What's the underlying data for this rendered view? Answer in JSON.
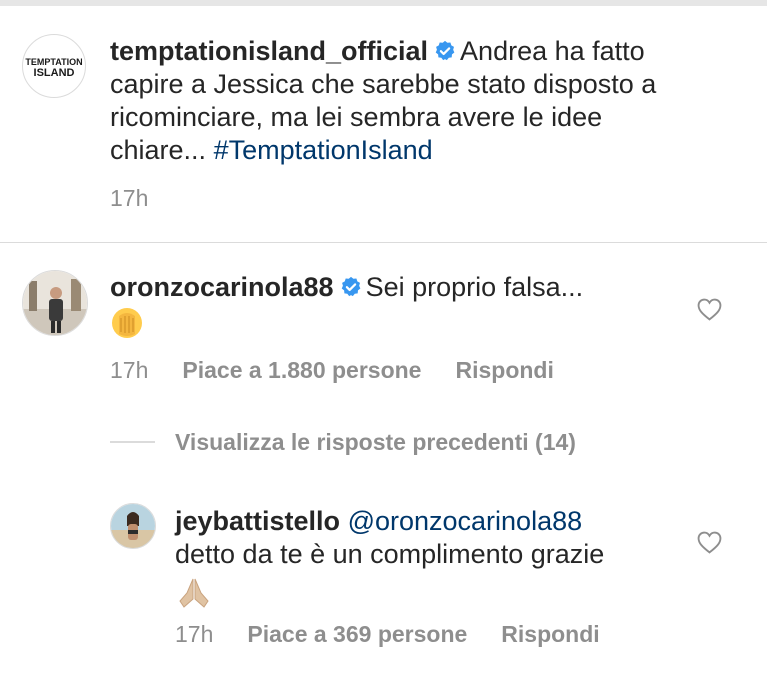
{
  "post": {
    "username": "temptationisland_official",
    "caption_line1": "Andrea ha fatto",
    "caption_line2": "capire a Jessica che sarebbe stato disposto a",
    "caption_line3": "ricominciare, ma lei sembra avere le idee",
    "caption_line4": "chiare...",
    "hashtag": "#TemptationIsland",
    "time": "17h",
    "avatar_logo_line1": "TEMPTATION",
    "avatar_logo_line2": "ISLAND"
  },
  "comment1": {
    "username": "oronzocarinola88",
    "text": "Sei proprio falsa...",
    "emoji_icon": "face-palm-icon",
    "time": "17h",
    "likes": "Piace a 1.880 persone",
    "reply": "Rispondi"
  },
  "view_replies": "Visualizza le risposte precedenti (14)",
  "reply1": {
    "username": "jeybattistello",
    "mention": "@oronzocarinola88",
    "text": "detto da te è un complimento grazie",
    "emoji_icon": "folded-hands-icon",
    "time": "17h",
    "likes": "Piace a 369 persone",
    "reply": "Rispondi"
  },
  "colors": {
    "verified": "#3897f0",
    "hashtag": "#00376b",
    "meta": "#8e8e8e",
    "divider": "#dbdbdb"
  }
}
